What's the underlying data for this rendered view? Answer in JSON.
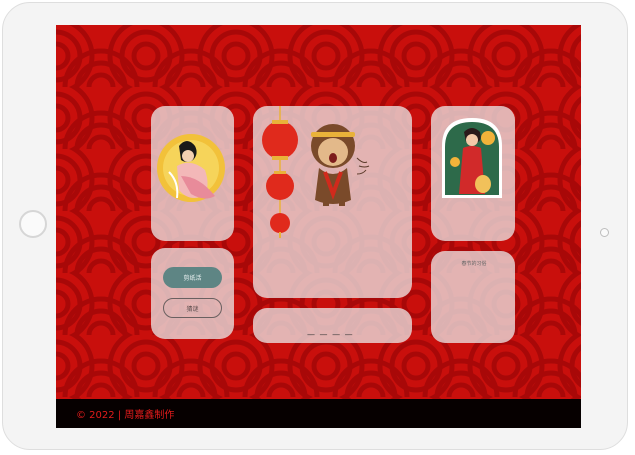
{
  "footer": {
    "text": "© 2022 | 周嘉鑫制作"
  },
  "left_panel": {
    "primary_button": "剪纸活",
    "secondary_button": "猜谜"
  },
  "center_panel": {
    "dash_text": "— — — —"
  },
  "right_panel": {
    "small_text": "春节的习俗"
  },
  "colors": {
    "background": "#c90f0c",
    "footer": "#060000",
    "accent": "#5e8584"
  },
  "icons": [
    "chang-e-illustration",
    "monkey-king-illustration",
    "lantern-icon",
    "woman-in-qipao-illustration"
  ]
}
